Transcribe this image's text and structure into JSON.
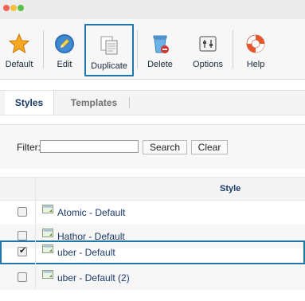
{
  "toolbar": {
    "items": [
      {
        "label": "Default",
        "icon": "star-icon"
      },
      {
        "label": "Edit",
        "icon": "pencil-icon"
      },
      {
        "label": "Duplicate",
        "icon": "duplicate-icon"
      },
      {
        "label": "Delete",
        "icon": "trash-icon"
      },
      {
        "label": "Options",
        "icon": "options-icon"
      },
      {
        "label": "Help",
        "icon": "lifebuoy-icon"
      }
    ]
  },
  "tabs": [
    {
      "label": "Styles",
      "active": true
    },
    {
      "label": "Templates",
      "active": false
    }
  ],
  "filter": {
    "label": "Filter:",
    "value": "",
    "search_label": "Search",
    "clear_label": "Clear"
  },
  "table": {
    "header_style": "Style",
    "rows": [
      {
        "name": "Atomic - Default",
        "checked": false
      },
      {
        "name": "Hathor - Default",
        "checked": false
      },
      {
        "name": "uber - Default",
        "checked": true
      },
      {
        "name": "uber - Default (2)",
        "checked": false
      }
    ]
  },
  "colors": {
    "accent": "#1f77a8",
    "link": "#1a3a6a"
  }
}
